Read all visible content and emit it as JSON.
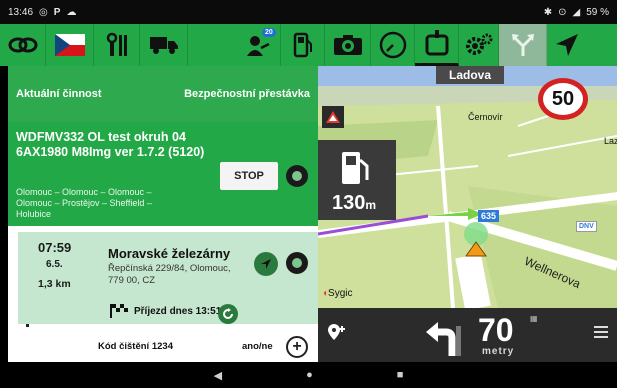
{
  "status_bar": {
    "time": "13:46",
    "battery": "59 %"
  },
  "toolbar": {
    "badge_count": "20"
  },
  "activity_bar": {
    "current_label": "Aktuální činnost",
    "break_label": "Bezpečnostní přestávka"
  },
  "tour": {
    "title": "WDFMV332 OL test okruh 04 6AX1980 M8Img ver 1.7.2 (5120)",
    "route": "Olomouc – Olomouc – Olomouc – Olomouc – Prostějov – Sheffield – Holubice",
    "stop_label": "STOP"
  },
  "stop_card": {
    "time": "07:59",
    "date": "6.5.",
    "distance": "1,3 km",
    "name": "Moravské železárny",
    "address": "Řepčínská 229/84, Olomouc, 779 00, CZ",
    "arrival": "Příjezd dnes 13:51"
  },
  "clean_row": {
    "label": "Kód čištění 1234",
    "option": "ano/ne",
    "plus": "+"
  },
  "map": {
    "street": "Ladova",
    "speed_limit": "50",
    "poi_distance": "130",
    "poi_unit": "m",
    "label_cernovir": "Černovír",
    "label_wellnerova": "Wellnerova",
    "label_laz": "Laz",
    "road_number": "635",
    "brand": "Sygic",
    "dnv": "DNV"
  },
  "nav_bar": {
    "distance": "70",
    "unit": "metry"
  },
  "colors": {
    "toolbar_green": "#23a847",
    "light_green": "#c6e7cf",
    "speed_red": "#d42121"
  }
}
